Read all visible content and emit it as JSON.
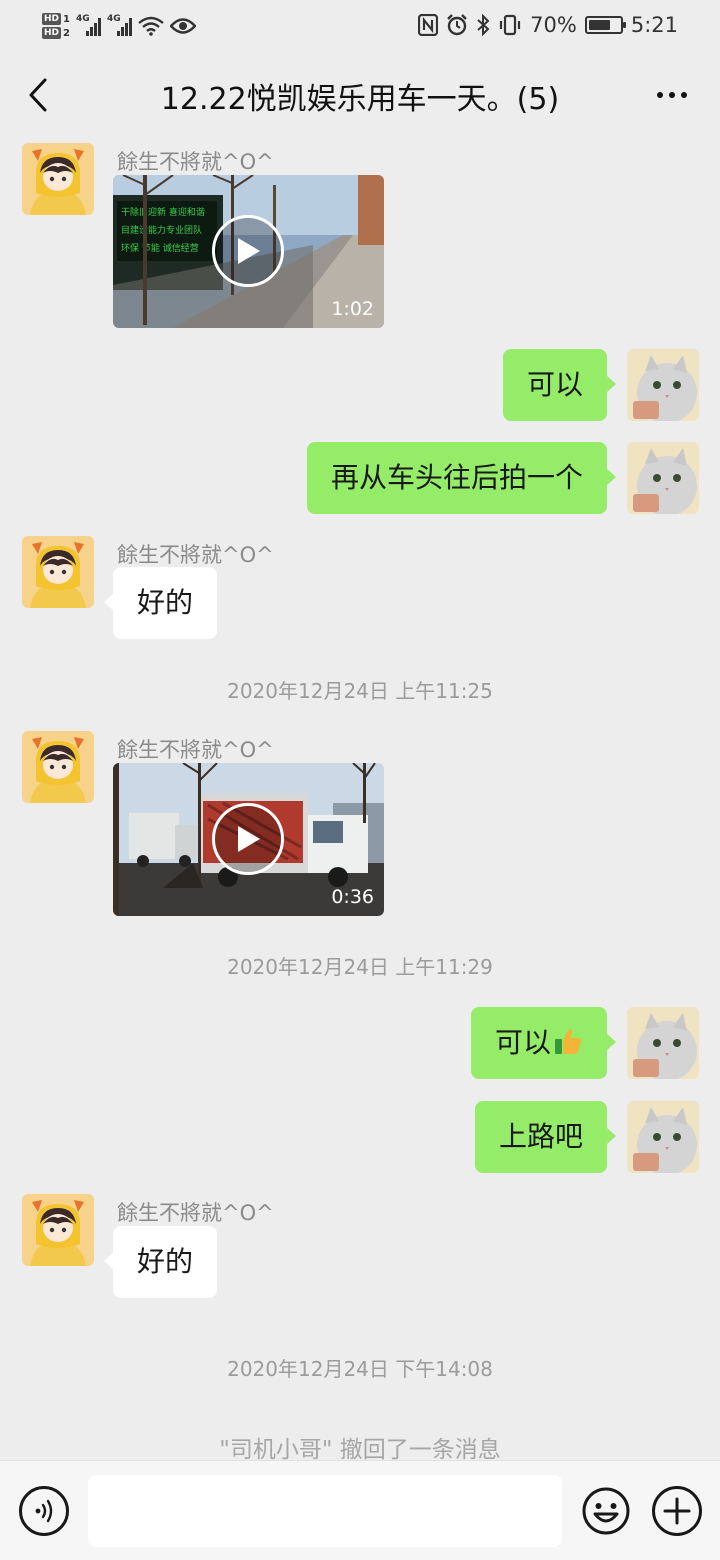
{
  "status_bar": {
    "hd1": "HD",
    "hd1_slot": "1",
    "hd2": "HD",
    "hd2_slot": "2",
    "network1": "4G",
    "network2": "4G",
    "battery": "70%",
    "time": "5:21"
  },
  "header": {
    "title": "12.22悦凯娱乐用车一天。(5)"
  },
  "messages": [
    {
      "sender_name": "餘生不將就^O^",
      "video_duration": "1:02"
    },
    {
      "text": "可以"
    },
    {
      "text": "再从车头往后拍一个"
    },
    {
      "sender_name": "餘生不將就^O^",
      "text": "好的"
    },
    {
      "timestamp": "2020年12月24日 上午11:25"
    },
    {
      "sender_name": "餘生不將就^O^",
      "video_duration": "0:36"
    },
    {
      "timestamp": "2020年12月24日 上午11:29"
    },
    {
      "text": "可以",
      "emoji": "thumbs-up"
    },
    {
      "text": "上路吧"
    },
    {
      "sender_name": "餘生不將就^O^",
      "text": "好的"
    },
    {
      "timestamp": "2020年12月24日 下午14:08"
    },
    {
      "system": "\"司机小哥\" 撤回了一条消息"
    }
  ],
  "input_bar": {
    "placeholder": ""
  },
  "colors": {
    "background": "#ededed",
    "sent_bubble": "#95ec69",
    "received_bubble": "#ffffff",
    "meta_text": "#9b9b9b"
  },
  "icons": [
    "back-icon",
    "more-icon",
    "voice-icon",
    "emoji-icon",
    "plus-icon",
    "play-icon",
    "thumbs-up-icon"
  ]
}
